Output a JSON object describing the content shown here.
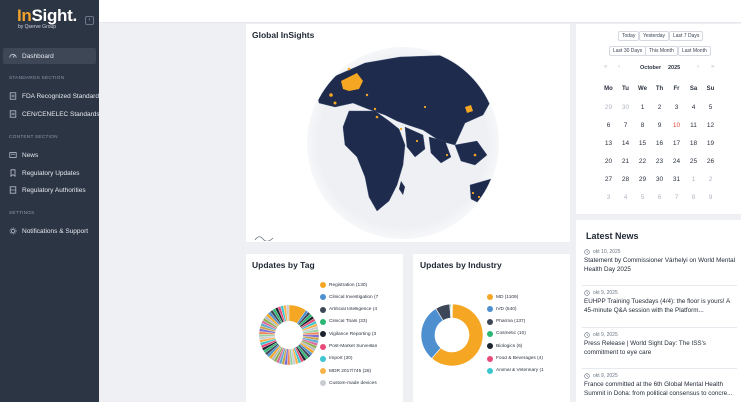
{
  "brand": {
    "logo_main_accent": "In",
    "logo_main_rest": "Sight.",
    "logo_sub": "by Qserve Group"
  },
  "sidebar": {
    "dashboard": "Dashboard",
    "section_standards": "STANDARDS SECTION",
    "fda": "FDA Recognized Standards",
    "cen": "CEN/CENELEC Standards",
    "section_content": "CONTENT SECTION",
    "news": "News",
    "regulatory_updates": "Regulatory Updates",
    "regulatory_authorities": "Regulatory Authorities",
    "section_settings": "SETTINGS",
    "notifications": "Notifications & Support"
  },
  "global": {
    "title": "Global InSights"
  },
  "calendar": {
    "quick_ranges": [
      "Today",
      "Yesterday",
      "Last 7 Days",
      "Last 30 Days",
      "This Month",
      "Last Month"
    ],
    "month": "October",
    "year": "2025",
    "prev_year": "«",
    "prev_month": "‹",
    "next_month": "›",
    "next_year": "»",
    "weekdays": [
      "Mo",
      "Tu",
      "We",
      "Th",
      "Fr",
      "Sa",
      "Su"
    ],
    "weeks": [
      [
        "29",
        "30",
        "1",
        "2",
        "3",
        "4",
        "5"
      ],
      [
        "6",
        "7",
        "8",
        "9",
        "10",
        "11",
        "12"
      ],
      [
        "13",
        "14",
        "15",
        "16",
        "17",
        "18",
        "19"
      ],
      [
        "20",
        "21",
        "22",
        "23",
        "24",
        "25",
        "26"
      ],
      [
        "27",
        "28",
        "29",
        "30",
        "31",
        "1",
        "2"
      ],
      [
        "3",
        "4",
        "5",
        "6",
        "7",
        "8",
        "9"
      ]
    ],
    "today": "10"
  },
  "latest_news": {
    "title": "Latest News",
    "items": [
      {
        "date": "okt 10, 2025",
        "title": "Statement by Commissioner Várhelyi on World Mental Health Day 2025"
      },
      {
        "date": "okt 9, 2025",
        "title": "EUHPP Training Tuesdays (4/4): the floor is yours! A 45-minute Q&A session with the Platform..."
      },
      {
        "date": "okt 9, 2025",
        "title": "Press Release | World Sight Day: The ISS's commitment to eye care"
      },
      {
        "date": "okt 9, 2025",
        "title": "France committed at the 6th Global Mental Health Summit in Doha: from political consensus to concre..."
      }
    ]
  },
  "updates_by_tag": {
    "title": "Updates by Tag",
    "legend": [
      {
        "label": "Registration (130)",
        "color": "#f5a623"
      },
      {
        "label": "Clinical Investigation (7",
        "color": "#4e8fd0"
      },
      {
        "label": "Artificial Intelligence (4",
        "color": "#3d4757"
      },
      {
        "label": "Clinical Trials (33)",
        "color": "#2bb673"
      },
      {
        "label": "Vigilance Reporting (3",
        "color": "#1d2430"
      },
      {
        "label": "Post-Market Surveillan",
        "color": "#e84b7a"
      },
      {
        "label": "Import (30)",
        "color": "#3cc6d0"
      },
      {
        "label": "MDR 2017/745 (26)",
        "color": "#f7b24a"
      },
      {
        "label": "Custom-made devices",
        "color": "#c9ccd2"
      }
    ]
  },
  "updates_by_industry": {
    "title": "Updates by Industry",
    "legend": [
      {
        "label": "MD (1109)",
        "color": "#f5a623"
      },
      {
        "label": "IVD (540)",
        "color": "#4e8fd0"
      },
      {
        "label": "Pharma (137)",
        "color": "#3d4757"
      },
      {
        "label": "Cosmetic (10)",
        "color": "#2bb673"
      },
      {
        "label": "Biologics (6)",
        "color": "#1d2430"
      },
      {
        "label": "Food & Beverages (4)",
        "color": "#e84b7a"
      },
      {
        "label": "Animal & Veterinary (1",
        "color": "#3cc6d0"
      }
    ]
  },
  "chart_data": [
    {
      "type": "pie",
      "title": "Updates by Industry",
      "categories": [
        "MD",
        "IVD",
        "Pharma",
        "Cosmetic",
        "Biologics",
        "Food & Beverages",
        "Animal & Veterinary"
      ],
      "values": [
        1109,
        540,
        137,
        10,
        6,
        4,
        1
      ]
    }
  ]
}
